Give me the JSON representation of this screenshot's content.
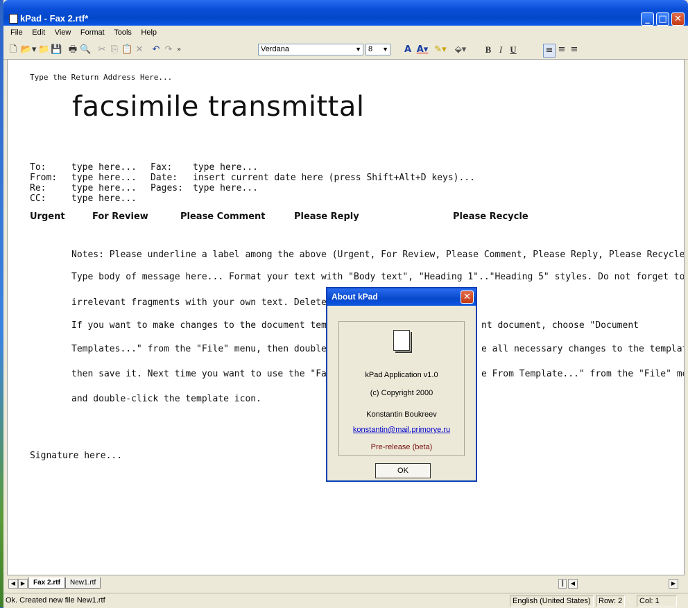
{
  "window": {
    "title": "kPad - Fax 2.rtf*"
  },
  "menu": [
    "File",
    "Edit",
    "View",
    "Format",
    "Tools",
    "Help"
  ],
  "toolbar": {
    "font": "Verdana",
    "size": "8"
  },
  "document": {
    "return_address": "Type the Return Address Here...",
    "heading": "facsimile transmittal",
    "rows": [
      {
        "k1": "To:",
        "v1": "type here...",
        "k2": "Fax:",
        "v2": "type here..."
      },
      {
        "k1": "From:",
        "v1": "type here...",
        "k2": "Date:",
        "v2": "insert current date here (press Shift+Alt+D keys)..."
      },
      {
        "k1": "Re:",
        "v1": "type here...",
        "k2": "Pages:",
        "v2": "type here..."
      },
      {
        "k1": "CC:",
        "v1": "type here...",
        "k2": "",
        "v2": ""
      }
    ],
    "flags": [
      "Urgent",
      "For Review",
      "Please Comment",
      "Please Reply",
      "Please Recycle"
    ],
    "body": [
      "Notes: Please underline a label among the above (Urgent, For Review, Please Comment, Please Reply, Please Recycle).",
      "Type body of message here... Format your text with \"Body text\", \"Heading 1\"..\"Heading 5\" styles. Do not forget to replace all",
      "irrelevant fragments with your own text. Delete wher",
      "If you want to make changes to the document templa",
      "nt document, choose \"Document",
      "Templates...\" from the \"File\" menu, then double-click",
      "e all necessary changes to the template,",
      "then save it. Next time you want to use the \"Fax 2\" t",
      "e From Template...\" from the \"File\" menu",
      "and double-click the template icon."
    ],
    "signature": "Signature here..."
  },
  "tabs": [
    "Fax 2.rtf",
    "New1.rtf"
  ],
  "status": {
    "message": "Ok. Created new file New1.rtf",
    "language": "English (United States)",
    "row": "Row: 2",
    "col": "Col: 1"
  },
  "dialog": {
    "title": "About kPad",
    "app": "kPad Application v1.0",
    "copyright": "(c) Copyright 2000",
    "author": "Konstantin Boukreev",
    "email": "konstantin@mail.primorye.ru",
    "release": "Pre-release (beta)",
    "ok": "OK"
  }
}
